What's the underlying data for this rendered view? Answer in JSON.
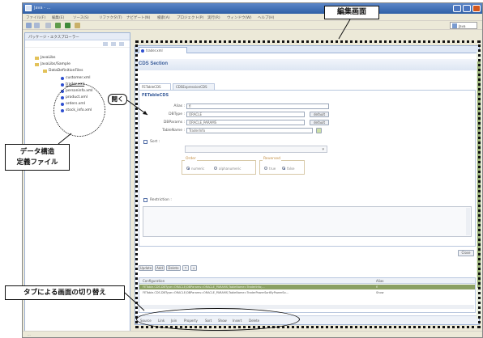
{
  "window": {
    "title": "Java - ...",
    "menu": [
      "ファイル(F)",
      "編集(E)",
      "ソース(S)",
      "リファクタ(T)",
      "ナビゲート(N)",
      "検索(A)",
      "プロジェクト(P)",
      "実行(R)",
      "ウィンドウ(W)",
      "ヘルプ(H)"
    ],
    "perspective": "Java"
  },
  "explorer": {
    "title": "パッケージ・エクスプローラー",
    "tree": [
      {
        "label": "JavaLibs",
        "level": 0,
        "icon": "folder-icon"
      },
      {
        "label": "JavaLibs/Sample",
        "level": 0,
        "icon": "folder-icon"
      },
      {
        "label": "DataDefinitionFiles",
        "level": 1,
        "icon": "folder-icon"
      },
      {
        "label": "customer.xml",
        "level": 2,
        "icon": "file-icon"
      },
      {
        "label": "trader.xml",
        "level": 2,
        "icon": "file-icon",
        "selected": true
      },
      {
        "label": "personinfo.xml",
        "level": 2,
        "icon": "file-icon"
      },
      {
        "label": "product.xml",
        "level": 2,
        "icon": "file-icon"
      },
      {
        "label": "orders.xml",
        "level": 2,
        "icon": "file-icon"
      },
      {
        "label": "stock_info.xml",
        "level": 2,
        "icon": "file-icon"
      }
    ]
  },
  "editor": {
    "tab_label": "trader.xml",
    "section_title": "CDS Section",
    "inner_tabs": [
      "FETableCDS",
      "CDSExpressionCDS"
    ],
    "form_title": "FETableCDS",
    "fields": {
      "alias_label": "Alias :",
      "alias_value": "fl",
      "dbtype_label": "DBType :",
      "dbtype_value": "ORACLE",
      "dbtype_button": "default",
      "dbparams_label": "DBParams :",
      "dbparams_value": "ORACLE_PARAMS",
      "dbparams_button": "default",
      "tablename_label": "TableName :",
      "tablename_value": "TraderInfo"
    },
    "sort": {
      "label": "Sort :",
      "order_label": "Order",
      "order_options": [
        "numeric",
        "alphanumeric"
      ],
      "reversed_label": "Reversed",
      "reversed_options": [
        "true",
        "false"
      ]
    },
    "restriction_label": "Restriction :",
    "close_button": "Close",
    "table_buttons": [
      "Update",
      "Add",
      "Delete",
      "↑",
      "↓"
    ],
    "config_table": {
      "columns": [
        "Configuration",
        "Alias"
      ],
      "rows": [
        {
          "configuration": "FETable.CDS.DBType=ORACLE;DBParams=ORACLE_PARAMS;TableName=TraderInfo;...",
          "alias": "fl"
        },
        {
          "configuration": "FETable.CDS.DBType=ORACLE;DBParams=ORACLE_PARAMS;TableName=TraderPowerSortByPowerSo...",
          "alias": "Show"
        }
      ]
    },
    "bottom_tabs": [
      "Source",
      "Link",
      "Join",
      "Property",
      "Sort",
      "Show",
      "Insert",
      "Delete"
    ]
  },
  "status": {
    "text": "..."
  },
  "callouts": {
    "edit_screen": "編集画面",
    "data_file_line1": "データ構造",
    "data_file_line2": "定義ファイル",
    "tab_switch": "タブによる画面の切り替え",
    "open": "開く"
  }
}
